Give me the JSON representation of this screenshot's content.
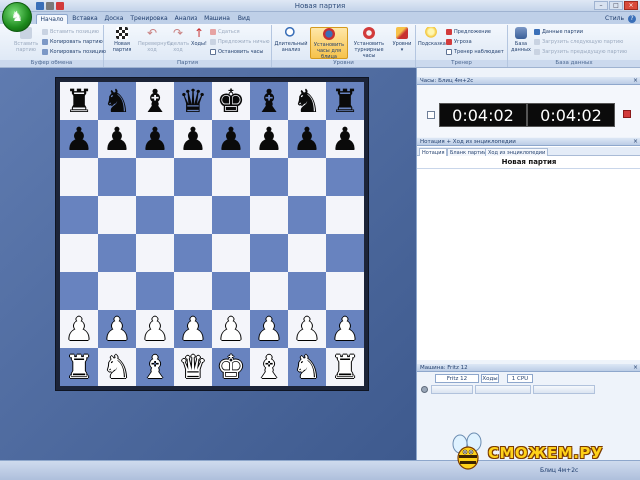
{
  "window": {
    "title": "Новая партия"
  },
  "quick_access": [
    "save-icon",
    "undo-icon",
    "stop-icon"
  ],
  "tabs": [
    {
      "label": "Начало",
      "active": true
    },
    {
      "label": "Вставка",
      "active": false
    },
    {
      "label": "Доска",
      "active": false
    },
    {
      "label": "Тренировка",
      "active": false
    },
    {
      "label": "Анализ",
      "active": false
    },
    {
      "label": "Машина",
      "active": false
    },
    {
      "label": "Вид",
      "active": false
    }
  ],
  "style_menu": "Стиль",
  "ribbon": {
    "clipboard": {
      "label": "Буфер обмена",
      "paste": "Вставить позицию",
      "paste_line1": "Вставить",
      "paste_line2": "партию",
      "copy_game": "Копировать партию",
      "copy_position": "Копировать позицию"
    },
    "game": {
      "label": "Партия",
      "new_line1": "Новая",
      "new_line2": "партия",
      "redo_line1": "Перевернуть",
      "redo_line2": "ход",
      "undo_line1": "Сделать",
      "undo_line2": "ход",
      "moves": "Ходы!",
      "resign": "Сдаться",
      "offer_draw": "Предложить ничью",
      "stop_clocks": "Остановить часы"
    },
    "levels": {
      "label": "Уровни",
      "long_line1": "Длительный",
      "long_line2": "анализ",
      "blitz_line1": "Установить",
      "blitz_line2": "часы для блица",
      "tournament_line1": "Установить",
      "tournament_line2": "турнирные часы",
      "levels_btn": "Уровни"
    },
    "trainer": {
      "label": "Тренер",
      "hint": "Подсказка",
      "suggestion": "Предложение",
      "threat": "Угроза",
      "trainer_watch": "Тренер наблюдает"
    },
    "database": {
      "label": "База данных",
      "db_line1": "База",
      "db_line2": "данных",
      "game_data": "Данные партии",
      "load_next": "Загрузить следующую партию",
      "load_prev": "Загрузить предыдущую партию"
    }
  },
  "board": {
    "ranks": [
      [
        "♜",
        "♞",
        "♝",
        "♛",
        "♚",
        "♝",
        "♞",
        "♜"
      ],
      [
        "♟",
        "♟",
        "♟",
        "♟",
        "♟",
        "♟",
        "♟",
        "♟"
      ],
      [
        "",
        "",
        "",
        "",
        "",
        "",
        "",
        ""
      ],
      [
        "",
        "",
        "",
        "",
        "",
        "",
        "",
        ""
      ],
      [
        "",
        "",
        "",
        "",
        "",
        "",
        "",
        ""
      ],
      [
        "",
        "",
        "",
        "",
        "",
        "",
        "",
        ""
      ],
      [
        "♟",
        "♟",
        "♟",
        "♟",
        "♟",
        "♟",
        "♟",
        "♟"
      ],
      [
        "♜",
        "♞",
        "♝",
        "♛",
        "♚",
        "♝",
        "♞",
        "♜"
      ]
    ],
    "colors": {
      "light": "#f4f5fa",
      "dark": "#6883bf"
    }
  },
  "clock_pane": {
    "title": "Часы: Блиц 4м+2с",
    "white_time": "0:04:02",
    "black_time": "0:04:02"
  },
  "notation_pane": {
    "title": "Нотация + Ход из энциклопедии",
    "subtabs": [
      "Нотация",
      "Бланк партии",
      "Ход из энциклопедии"
    ],
    "game_title": "Новая партия"
  },
  "engine_pane": {
    "title": "Машина: Fritz 12",
    "engine_name": "Fritz 12",
    "moves_btn": "Ходы",
    "cpu": "1 CPU"
  },
  "status": {
    "mode": "Блиц 4м+2с"
  },
  "watermark": "СМОЖЕМ.РУ"
}
